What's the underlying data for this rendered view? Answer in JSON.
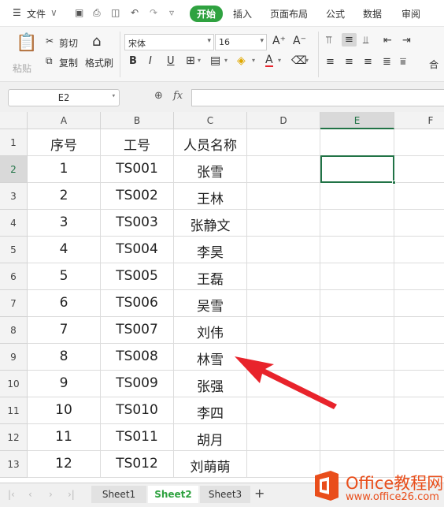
{
  "menubar": {
    "items": [
      "文件",
      "开始",
      "插入",
      "页面布局",
      "公式",
      "数据",
      "审阅"
    ],
    "active": "开始"
  },
  "ribbon": {
    "paste": "粘贴",
    "cut": "剪切",
    "copy": "复制",
    "format_painter": "格式刷",
    "font_name": "宋体",
    "font_size": "16",
    "bold": "B",
    "italic": "I",
    "underline": "U",
    "font_color_glyph": "A",
    "grow_font": "A⁺",
    "shrink_font": "A⁻",
    "merge": "合"
  },
  "formula_bar": {
    "name_box": "E2",
    "fx": "fx",
    "value": ""
  },
  "columns": [
    "A",
    "B",
    "C",
    "D",
    "E",
    "F"
  ],
  "selected_column": "E",
  "selected_row": "2",
  "rows": [
    {
      "num": "1",
      "a": "序号",
      "b": "工号",
      "c": "人员名称"
    },
    {
      "num": "2",
      "a": "1",
      "b": "TS001",
      "c": "张雪"
    },
    {
      "num": "3",
      "a": "2",
      "b": "TS002",
      "c": "王林"
    },
    {
      "num": "4",
      "a": "3",
      "b": "TS003",
      "c": "张静文"
    },
    {
      "num": "5",
      "a": "4",
      "b": "TS004",
      "c": "李昊"
    },
    {
      "num": "6",
      "a": "5",
      "b": "TS005",
      "c": "王磊"
    },
    {
      "num": "7",
      "a": "6",
      "b": "TS006",
      "c": "吴雪"
    },
    {
      "num": "8",
      "a": "7",
      "b": "TS007",
      "c": "刘伟"
    },
    {
      "num": "9",
      "a": "8",
      "b": "TS008",
      "c": "林雪"
    },
    {
      "num": "10",
      "a": "9",
      "b": "TS009",
      "c": "张强"
    },
    {
      "num": "11",
      "a": "10",
      "b": "TS010",
      "c": "李四"
    },
    {
      "num": "12",
      "a": "11",
      "b": "TS011",
      "c": "胡月"
    },
    {
      "num": "13",
      "a": "12",
      "b": "TS012",
      "c": "刘萌萌"
    }
  ],
  "sheets": [
    "Sheet1",
    "Sheet2",
    "Sheet3"
  ],
  "active_sheet": "Sheet2",
  "watermark": {
    "line1": "Office教程网",
    "line2": "www.office26.com"
  },
  "colors": {
    "accent": "#2fa240",
    "selection": "#217346",
    "arrow": "#e8232b",
    "watermark": "#e94e1b"
  }
}
